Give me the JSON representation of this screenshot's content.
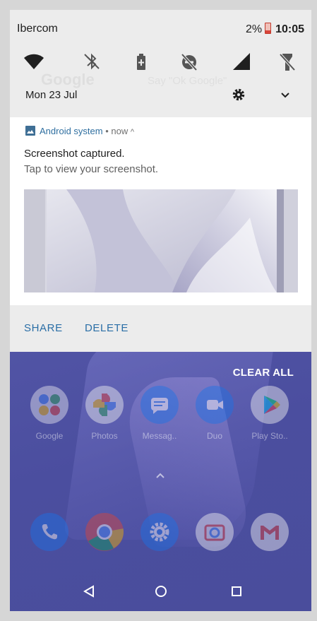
{
  "status_bar": {
    "carrier": "Ibercom",
    "battery_percent": "2%",
    "time": "10:05"
  },
  "quick_settings": [
    {
      "icon": "wifi-icon"
    },
    {
      "icon": "bluetooth-off-icon"
    },
    {
      "icon": "battery-saver-icon"
    },
    {
      "icon": "do-not-disturb-off-icon"
    },
    {
      "icon": "cellular-signal-icon"
    },
    {
      "icon": "flashlight-off-icon"
    }
  ],
  "shade_date": "Mon 23 Jul",
  "background_search": {
    "google": "Google",
    "ok_google": "Say \"Ok Google\""
  },
  "notification": {
    "app_name": "Android system",
    "separator": "•",
    "time": "now",
    "caret": "^",
    "title": "Screenshot captured.",
    "text": "Tap to view your screenshot.",
    "actions": {
      "share": "SHARE",
      "delete": "DELETE"
    }
  },
  "home": {
    "clear_all": "CLEAR ALL",
    "apps": [
      {
        "label": "Google"
      },
      {
        "label": "Photos"
      },
      {
        "label": "Messag.."
      },
      {
        "label": "Duo"
      },
      {
        "label": "Play Sto.."
      }
    ],
    "dock": [
      {
        "icon": "phone-icon"
      },
      {
        "icon": "chrome-icon"
      },
      {
        "icon": "settings-app-icon"
      },
      {
        "icon": "camera-icon"
      },
      {
        "icon": "gmail-icon"
      }
    ]
  },
  "colors": {
    "shade_background": "#ececec",
    "action_text": "#2a6ea6",
    "notification_header": "#2f6fa0",
    "wallpaper": "#4a4f9e"
  }
}
